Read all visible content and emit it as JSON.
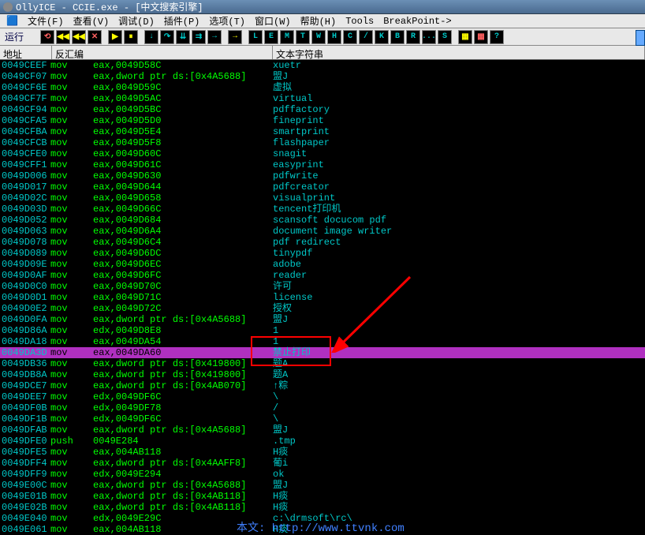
{
  "window": {
    "title": "OllyICE - CCIE.exe - [中文搜索引擎]"
  },
  "menu": {
    "file": "文件(F)",
    "view": "查看(V)",
    "debug": "调试(D)",
    "plugins": "插件(P)",
    "options": "选项(T)",
    "window": "窗口(W)",
    "help": "帮助(H)",
    "tools": "Tools",
    "breakpoint": "BreakPoint->"
  },
  "toolbar": {
    "run_label": "运行"
  },
  "columns": {
    "address": "地址",
    "disasm": "反汇编",
    "text": "文本字符串"
  },
  "highlight_index": 26,
  "rows": [
    {
      "a": "0049CEEF",
      "m": "mov",
      "o": "eax,0049D58C",
      "s": "xuetr"
    },
    {
      "a": "0049CF07",
      "m": "mov",
      "o": "eax,dword ptr ds:[0x4A5688]",
      "s": "盟J"
    },
    {
      "a": "0049CF6E",
      "m": "mov",
      "o": "eax,0049D59C",
      "s": "虚拟"
    },
    {
      "a": "0049CF7F",
      "m": "mov",
      "o": "eax,0049D5AC",
      "s": "virtual"
    },
    {
      "a": "0049CF94",
      "m": "mov",
      "o": "eax,0049D5BC",
      "s": "pdffactory"
    },
    {
      "a": "0049CFA5",
      "m": "mov",
      "o": "eax,0049D5D0",
      "s": "fineprint"
    },
    {
      "a": "0049CFBA",
      "m": "mov",
      "o": "eax,0049D5E4",
      "s": "smartprint"
    },
    {
      "a": "0049CFCB",
      "m": "mov",
      "o": "eax,0049D5F8",
      "s": "flashpaper"
    },
    {
      "a": "0049CFE0",
      "m": "mov",
      "o": "eax,0049D60C",
      "s": "snagit"
    },
    {
      "a": "0049CFF1",
      "m": "mov",
      "o": "eax,0049D61C",
      "s": "easyprint"
    },
    {
      "a": "0049D006",
      "m": "mov",
      "o": "eax,0049D630",
      "s": "pdfwrite"
    },
    {
      "a": "0049D017",
      "m": "mov",
      "o": "eax,0049D644",
      "s": "pdfcreator"
    },
    {
      "a": "0049D02C",
      "m": "mov",
      "o": "eax,0049D658",
      "s": "visualprint"
    },
    {
      "a": "0049D03D",
      "m": "mov",
      "o": "eax,0049D66C",
      "s": "tencent打印机"
    },
    {
      "a": "0049D052",
      "m": "mov",
      "o": "eax,0049D684",
      "s": "scansoft docucom pdf"
    },
    {
      "a": "0049D063",
      "m": "mov",
      "o": "eax,0049D6A4",
      "s": "document image writer"
    },
    {
      "a": "0049D078",
      "m": "mov",
      "o": "eax,0049D6C4",
      "s": "pdf redirect"
    },
    {
      "a": "0049D089",
      "m": "mov",
      "o": "eax,0049D6DC",
      "s": "tinypdf"
    },
    {
      "a": "0049D09E",
      "m": "mov",
      "o": "eax,0049D6EC",
      "s": "adobe"
    },
    {
      "a": "0049D0AF",
      "m": "mov",
      "o": "eax,0049D6FC",
      "s": "reader"
    },
    {
      "a": "0049D0C0",
      "m": "mov",
      "o": "eax,0049D70C",
      "s": "许可"
    },
    {
      "a": "0049D0D1",
      "m": "mov",
      "o": "eax,0049D71C",
      "s": "license"
    },
    {
      "a": "0049D0E2",
      "m": "mov",
      "o": "eax,0049D72C",
      "s": "授权"
    },
    {
      "a": "0049D0FA",
      "m": "mov",
      "o": "eax,dword ptr ds:[0x4A5688]",
      "s": "盟J"
    },
    {
      "a": "0049D86A",
      "m": "mov",
      "o": "edx,0049D8E8",
      "s": "1"
    },
    {
      "a": "0049DA18",
      "m": "mov",
      "o": "eax,0049DA54",
      "s": "1"
    },
    {
      "a": "0049DA3D",
      "m": "mov",
      "o": "eax,0049DA60",
      "s": "禁止打印"
    },
    {
      "a": "0049DB36",
      "m": "mov",
      "o": "eax,dword ptr ds:[0x419800]",
      "s": "题A"
    },
    {
      "a": "0049DB8A",
      "m": "mov",
      "o": "eax,dword ptr ds:[0x419800]",
      "s": "题A"
    },
    {
      "a": "0049DCE7",
      "m": "mov",
      "o": "eax,dword ptr ds:[0x4AB070]",
      "s": "↑粽"
    },
    {
      "a": "0049DEE7",
      "m": "mov",
      "o": "edx,0049DF6C",
      "s": "\\"
    },
    {
      "a": "0049DF0B",
      "m": "mov",
      "o": "edx,0049DF78",
      "s": "/"
    },
    {
      "a": "0049DF1B",
      "m": "mov",
      "o": "edx,0049DF6C",
      "s": "\\"
    },
    {
      "a": "0049DFAB",
      "m": "mov",
      "o": "eax,dword ptr ds:[0x4A5688]",
      "s": "盟J"
    },
    {
      "a": "0049DFE0",
      "m": "push",
      "o": "0049E284",
      "s": ".tmp"
    },
    {
      "a": "0049DFE5",
      "m": "mov",
      "o": "eax,004AB118",
      "s": "H痰"
    },
    {
      "a": "0049DFF4",
      "m": "mov",
      "o": "eax,dword ptr ds:[0x4AAFF8]",
      "s": "葡i"
    },
    {
      "a": "0049DFF9",
      "m": "mov",
      "o": "edx,0049E294",
      "s": "ok"
    },
    {
      "a": "0049E00C",
      "m": "mov",
      "o": "eax,dword ptr ds:[0x4A5688]",
      "s": "盟J"
    },
    {
      "a": "0049E01B",
      "m": "mov",
      "o": "eax,dword ptr ds:[0x4AB118]",
      "s": "H痰"
    },
    {
      "a": "0049E02B",
      "m": "mov",
      "o": "eax,dword ptr ds:[0x4AB118]",
      "s": "H痰"
    },
    {
      "a": "0049E040",
      "m": "mov",
      "o": "edx,0049E29C",
      "s": "c:\\drmsoft\\rc\\"
    },
    {
      "a": "0049E061",
      "m": "mov",
      "o": "eax,004AB118",
      "s": "H痰"
    }
  ],
  "tool_letters": [
    "L",
    "E",
    "M",
    "T",
    "W",
    "H",
    "C",
    "/",
    "K",
    "B",
    "R",
    "...",
    "S"
  ],
  "credit": "本文: http://www.ttvnk.com"
}
